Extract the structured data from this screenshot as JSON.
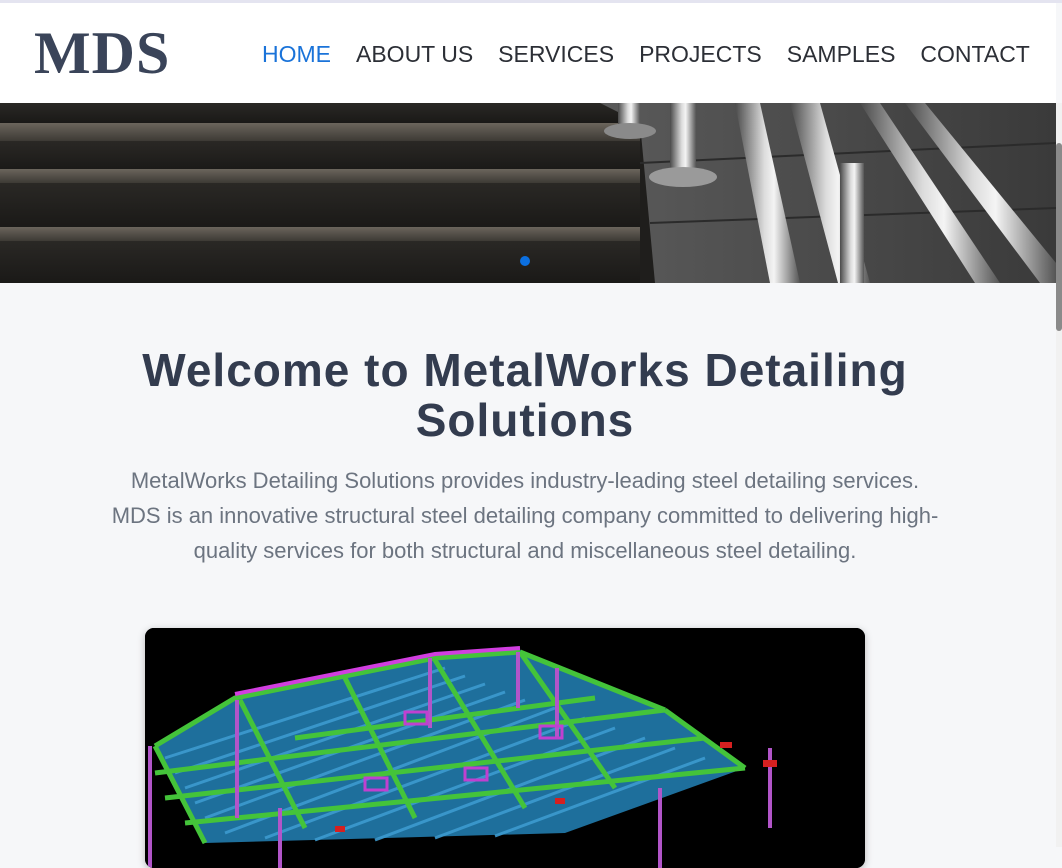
{
  "header": {
    "logo": "MDS",
    "nav": [
      {
        "label": "HOME",
        "active": true
      },
      {
        "label": "ABOUT US",
        "active": false
      },
      {
        "label": "SERVICES",
        "active": false
      },
      {
        "label": "PROJECTS",
        "active": false
      },
      {
        "label": "SAMPLES",
        "active": false
      },
      {
        "label": "CONTACT",
        "active": false
      }
    ]
  },
  "hero": {
    "image": "steel-staircase-railing-photo",
    "slide_indicator_active": 1
  },
  "main": {
    "title": "Welcome to MetalWorks Detailing Solutions",
    "intro": "MetalWorks Detailing Solutions provides industry-leading steel detailing services. MDS is an innovative structural steel detailing company committed to delivering high-quality services for both structural and miscellaneous steel detailing.",
    "model_image": "3d-structural-steel-model"
  },
  "colors": {
    "accent": "#1a73d9",
    "nav_text": "#2c2f36",
    "logo": "#3a4459",
    "title": "#333c4f",
    "body_text": "#6c7480",
    "page_bg": "#f6f7f9"
  }
}
